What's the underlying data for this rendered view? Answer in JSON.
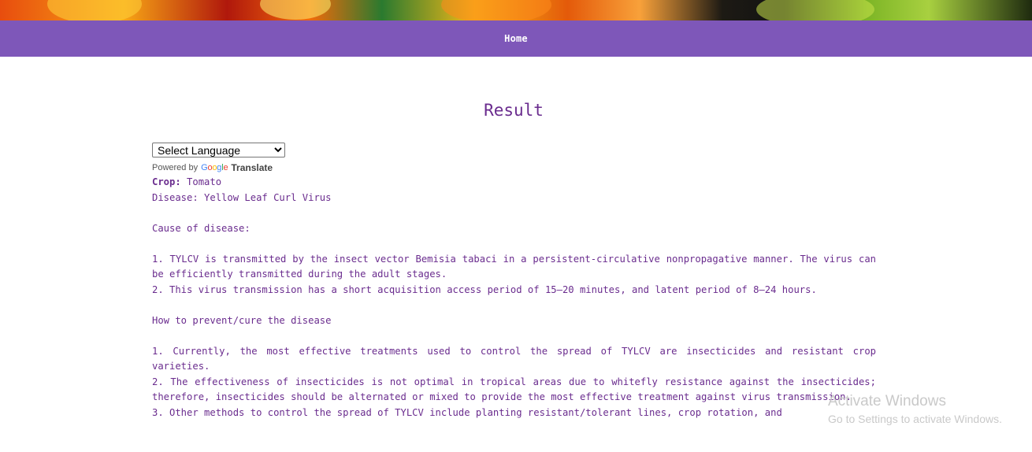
{
  "nav": {
    "home_label": "Home"
  },
  "page": {
    "title": "Result"
  },
  "translate": {
    "select_value": "Select Language",
    "powered_by": "Powered by",
    "google_logo": "Google",
    "translate_label": "Translate"
  },
  "result": {
    "crop_label": "Crop:",
    "crop_value": "Tomato",
    "disease_line": "Disease: Yellow Leaf Curl Virus",
    "cause_heading": "Cause of disease:",
    "causes": [
      "1. TYLCV is transmitted by the insect vector Bemisia tabaci in a persistent-circulative nonpropagative manner. The virus can be efficiently transmitted during the adult stages.",
      "2. This virus transmission has a short acquisition access period of 15–20 minutes, and latent period of 8–24 hours."
    ],
    "prevent_heading": "How to prevent/cure the disease",
    "prevention": [
      "1. Currently, the most effective treatments used to control the spread of TYLCV are insecticides and resistant crop varieties.",
      "2. The effectiveness of insecticides is not optimal in tropical areas due to whitefly resistance against the insecticides; therefore, insecticides should be alternated or mixed to provide the most effective treatment against virus transmission.",
      "3. Other methods to control the spread of TYLCV include planting resistant/tolerant lines, crop rotation, and"
    ]
  },
  "os_watermark": {
    "line1": "Activate Windows",
    "line2": "Go to Settings to activate Windows."
  },
  "colors": {
    "navbar": "#7e57b9",
    "text": "#6a2c8e"
  }
}
